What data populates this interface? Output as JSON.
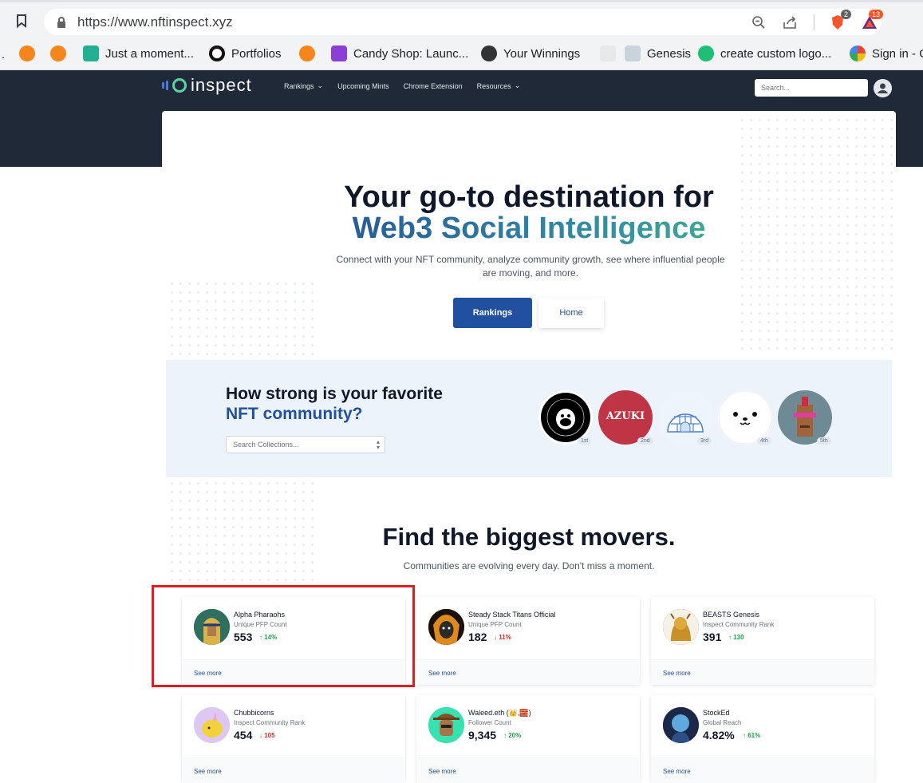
{
  "browser": {
    "url": "https://www.nftinspect.xyz",
    "brave_badge": "2",
    "rewards_badge": "13",
    "bookmarks": [
      {
        "label": "Just a moment...",
        "icon": "kucoin-icon",
        "color": "#23af91"
      },
      {
        "label": "Portfolios",
        "icon": "c-logo-icon",
        "color": "#111111"
      },
      {
        "label": "Candy Shop: Launc...",
        "icon": "candy-shop-icon",
        "color": "#8b3fd6"
      },
      {
        "label": "Your Winnings",
        "icon": "ape-icon",
        "color": "#333333"
      },
      {
        "label": "Genesis",
        "icon": "genesis-icon",
        "color": "#888888"
      },
      {
        "label": "create custom logo...",
        "icon": "fiverr-icon",
        "color": "#1dbf73"
      },
      {
        "label": "Sign in - G",
        "icon": "google-icon",
        "color": "#4285f4"
      }
    ]
  },
  "site": {
    "logo_text": "inspect",
    "nav": [
      "Rankings",
      "Upcoming Mints",
      "Chrome Extension",
      "Resources"
    ],
    "search_placeholder": "Search..."
  },
  "hero": {
    "title_line1": "Your go-to destination for",
    "title_line2": "Web3 Social Intelligence",
    "subtitle": "Connect with your NFT community, analyze community growth, see where influential people are moving, and more.",
    "btn_primary": "Rankings",
    "btn_secondary": "Home"
  },
  "community": {
    "q1": "How strong is your favorite",
    "q2": "NFT community?",
    "select_placeholder": "Search Collections...",
    "ranks": [
      "1st",
      "2nd",
      "3rd",
      "4th",
      "5th"
    ],
    "azuki_text": "AZUKI"
  },
  "movers": {
    "title": "Find the biggest movers.",
    "subtitle": "Communities are evolving every day. Don't miss a moment.",
    "see_more": "See more",
    "cards": [
      {
        "name": "Alpha Pharaohs",
        "metric": "Unique PFP Count",
        "value": "553",
        "delta": "14%",
        "direction": "up",
        "avatar": "pharaoh-avatar"
      },
      {
        "name": "Steady Stack Titans Official",
        "metric": "Unique PFP Count",
        "value": "182",
        "delta": "11%",
        "direction": "down",
        "avatar": "titan-avatar"
      },
      {
        "name": "BEASTS Genesis",
        "metric": "Inspect Community Rank",
        "value": "391",
        "delta": "130",
        "direction": "up",
        "avatar": "beast-avatar"
      },
      {
        "name": "Chubbicorns",
        "metric": "Inspect Community Rank",
        "value": "454",
        "delta": "105",
        "direction": "down",
        "avatar": "chubbicorn-avatar"
      },
      {
        "name": "Waleed.eth (👑,🧱)",
        "metric": "Follower Count",
        "value": "9,345",
        "delta": "20%",
        "direction": "up",
        "avatar": "waleed-avatar"
      },
      {
        "name": "StockEd",
        "metric": "Global Reach",
        "value": "4.82%",
        "delta": "61%",
        "direction": "up",
        "avatar": "stocked-avatar"
      }
    ]
  }
}
